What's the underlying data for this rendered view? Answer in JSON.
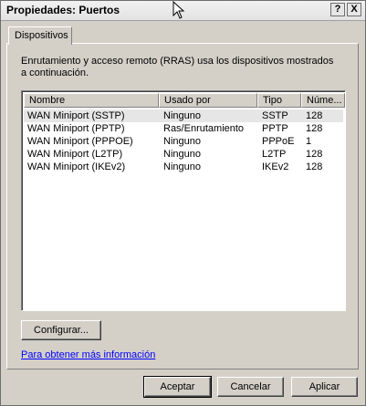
{
  "window": {
    "title": "Propiedades: Puertos",
    "help_button": "?",
    "close_button": "X"
  },
  "tabs": [
    {
      "label": "Dispositivos"
    }
  ],
  "description": "Enrutamiento y acceso remoto (RRAS) usa los dispositivos mostrados a continuación.",
  "table": {
    "columns": [
      "Nombre",
      "Usado por",
      "Tipo",
      "Núme..."
    ],
    "rows": [
      [
        "WAN Miniport (SSTP)",
        "Ninguno",
        "SSTP",
        "128"
      ],
      [
        "WAN Miniport (PPTP)",
        "Ras/Enrutamiento",
        "PPTP",
        "128"
      ],
      [
        "WAN Miniport (PPPOE)",
        "Ninguno",
        "PPPoE",
        "1"
      ],
      [
        "WAN Miniport (L2TP)",
        "Ninguno",
        "L2TP",
        "128"
      ],
      [
        "WAN Miniport (IKEv2)",
        "Ninguno",
        "IKEv2",
        "128"
      ]
    ]
  },
  "configure_button": "Configurar...",
  "more_info_link": "Para obtener más información",
  "footer": {
    "ok": "Aceptar",
    "cancel": "Cancelar",
    "apply": "Aplicar"
  }
}
